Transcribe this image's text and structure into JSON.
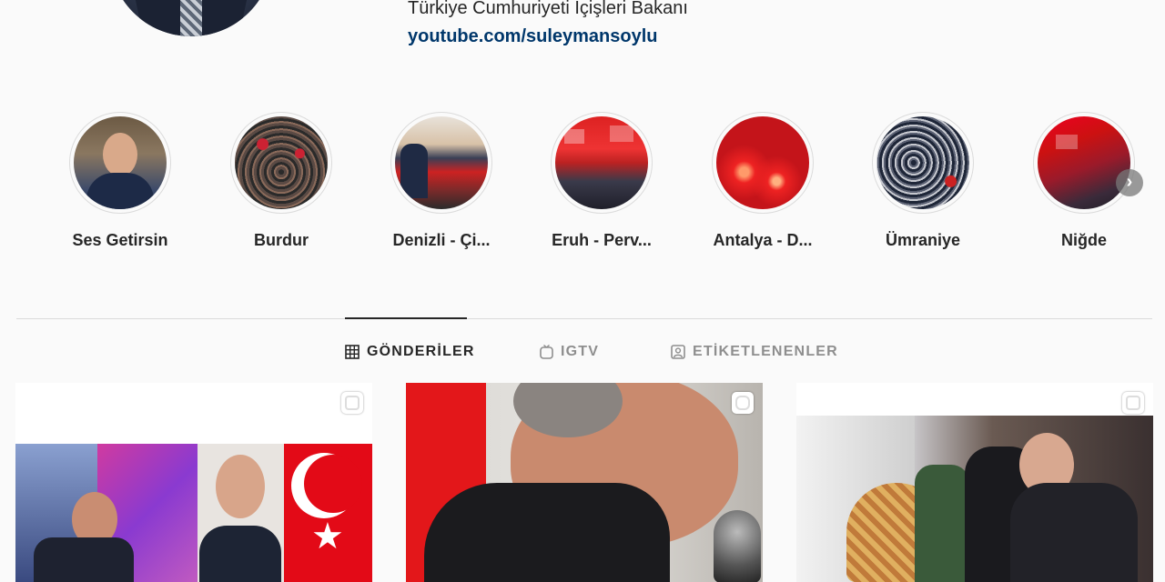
{
  "profile": {
    "bio": "Türkiye Cumhuriyeti İçişleri Bakanı",
    "link": "youtube.com/suleymansoylu"
  },
  "highlights": [
    {
      "label": "Ses Getirsin"
    },
    {
      "label": "Burdur"
    },
    {
      "label": "Denizli - Çi..."
    },
    {
      "label": "Eruh - Perv..."
    },
    {
      "label": "Antalya - D..."
    },
    {
      "label": "Ümraniye"
    },
    {
      "label": "Niğde"
    }
  ],
  "highlights_next_icon": "chevron-right-icon",
  "tabs": [
    {
      "label": "GÖNDERİLER",
      "icon": "grid-icon",
      "active": true
    },
    {
      "label": "IGTV",
      "icon": "igtv-icon",
      "active": false
    },
    {
      "label": "ETİKETLENENLER",
      "icon": "tagged-icon",
      "active": false
    }
  ],
  "posts": [
    {
      "type": "photo",
      "badge": "carousel-icon"
    },
    {
      "type": "video",
      "badge": "igtv-icon"
    },
    {
      "type": "photo",
      "badge": "carousel-icon"
    }
  ],
  "colors": {
    "background": "#fafafa",
    "text": "#262626",
    "link": "#00376b",
    "muted": "#8e8e8e",
    "border": "#dbdbdb"
  }
}
